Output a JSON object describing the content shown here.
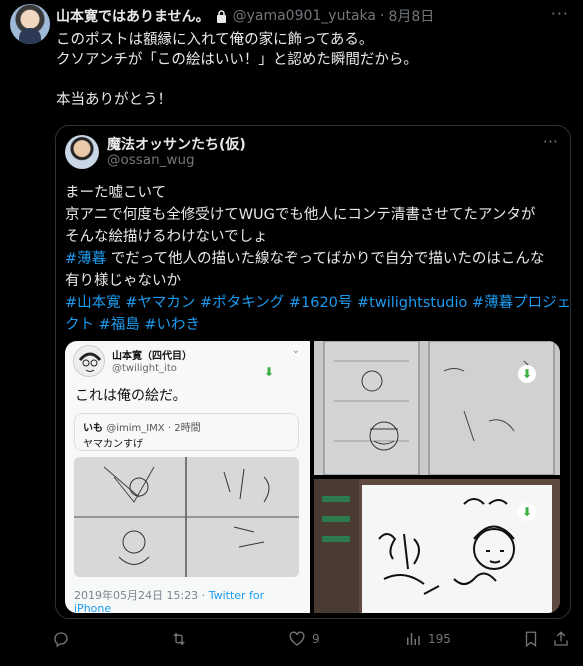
{
  "tweet": {
    "display_name": "山本寛ではありません。",
    "handle": "@yama0901_yutaka",
    "separator": "·",
    "date": "8月8日",
    "more": "···",
    "lines": [
      "このポストは額縁に入れて俺の家に飾ってある。",
      "クソアンチが「この絵はいい！」と認めた瞬間だから。",
      "",
      "本当ありがとう！"
    ]
  },
  "quoted": {
    "display_name": "魔法オッサンたち(仮)",
    "handle": "@ossan_wug",
    "more": "···",
    "lines": [
      "まーた嘘こいて",
      "京アニで何度も全修受けてWUGでも他人にコンテ清書させてたアンタが",
      "そんな絵描けるわけないでしょ",
      {
        "tag": "#薄暮",
        "text": " でだって他人の描いた線なぞってばかりで自分で描いたのはこんな"
      },
      "有り様じゃないか"
    ],
    "hashtags_line1": "#山本寛 #ヤマカン #ポタキング #1620号 #twilightstudio #薄暮プロジェ",
    "hashtags_line2": "クト #福島 #いわき"
  },
  "embedded": {
    "name": "山本寛（四代目）",
    "handle": "@twilight_ito",
    "chevron": "⌄",
    "text": "これは俺の絵だ。",
    "quote_name": "いも",
    "quote_handle": "@imim_IMX",
    "quote_time": "· 2時間",
    "quote_text": "ヤマカンすげ",
    "footer_date": "2019年05月24日 15:23 ·",
    "footer_source": "Twitter for iPhone"
  },
  "media_icons": {
    "download": "⬇"
  },
  "actions": {
    "reply_count": "",
    "retweet_count": "",
    "like_count": "9",
    "views_count": "195"
  },
  "colors": {
    "background": "#000000",
    "text": "#e7e9ea",
    "muted": "#71767b",
    "link": "#1d9bf0",
    "border": "#2f3336"
  }
}
